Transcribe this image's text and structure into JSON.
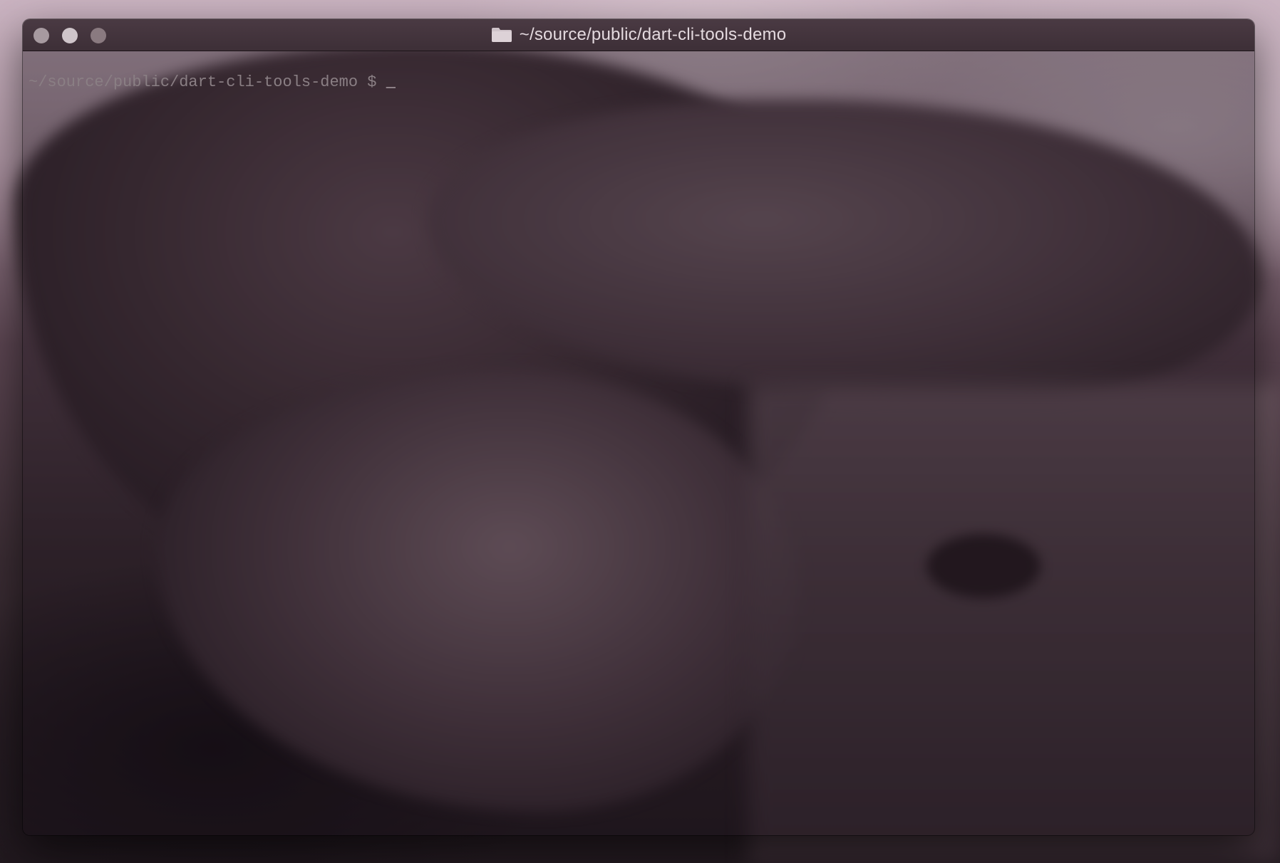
{
  "window": {
    "title": "~/source/public/dart-cli-tools-demo"
  },
  "titlebar": {
    "buttons": [
      "close",
      "minimize",
      "zoom"
    ],
    "folder_icon": "folder-icon"
  },
  "terminal": {
    "prompt": "~/source/public/dart-cli-tools-demo $ ",
    "cursor": "_"
  },
  "colors": {
    "titlebar": "#3d2f37",
    "title_text": "#e4dadf",
    "prompt_text": "#8a7f84"
  }
}
